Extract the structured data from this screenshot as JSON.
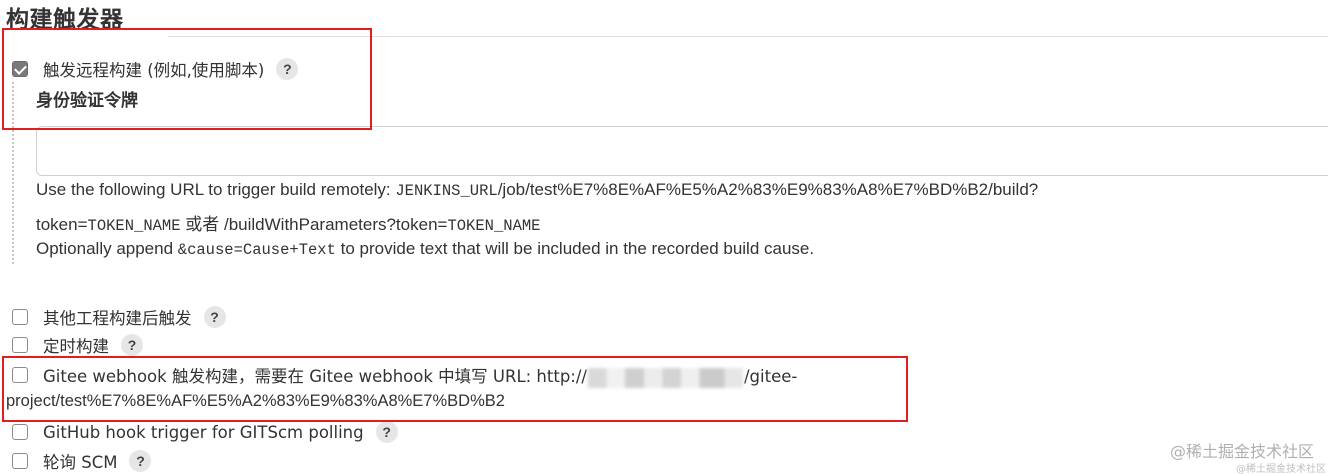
{
  "section": {
    "title": "构建触发器"
  },
  "triggers": {
    "remote": {
      "checked": true,
      "label": "触发远程构建 (例如,使用脚本)",
      "help": "?",
      "token_label": "身份验证令牌",
      "token_value": "",
      "help_line1_prefix": "Use the following URL to trigger build remotely: ",
      "help_line1_code": "JENKINS_URL",
      "help_line1_suffix": "/job/test%E7%8E%AF%E5%A2%83%E9%83%A8%E7%BD%B2/build?",
      "help_line2_prefix": "token=",
      "help_line2_code1": "TOKEN_NAME",
      "help_line2_mid": " 或者 /buildWithParameters?token=",
      "help_line2_code2": "TOKEN_NAME",
      "help_line3_prefix": "Optionally append ",
      "help_line3_code": "&cause=Cause+Text",
      "help_line3_suffix": " to provide text that will be included in the recorded build cause."
    },
    "upstream": {
      "checked": false,
      "label": "其他工程构建后触发",
      "help": "?"
    },
    "cron": {
      "checked": false,
      "label": "定时构建",
      "help": "?"
    },
    "gitee": {
      "checked": false,
      "label_prefix": "Gitee webhook 触发构建，需要在 Gitee webhook 中填写 URL: http://",
      "label_suffix": "/gitee-",
      "label_line2": "project/test%E7%8E%AF%E5%A2%83%E9%83%A8%E7%BD%B2"
    },
    "github": {
      "checked": false,
      "label": "GitHub hook trigger for GITScm polling",
      "help": "?"
    },
    "poll": {
      "checked": false,
      "label": "轮询 SCM",
      "help": "?"
    }
  },
  "watermark": {
    "text": "@稀土掘金技术社区",
    "text_small": "@稀土掘金技术社区"
  },
  "colors": {
    "highlight": "#e01e1e",
    "checkbox_checked": "#7a7a7a",
    "help_bg": "#e6e6e6"
  }
}
